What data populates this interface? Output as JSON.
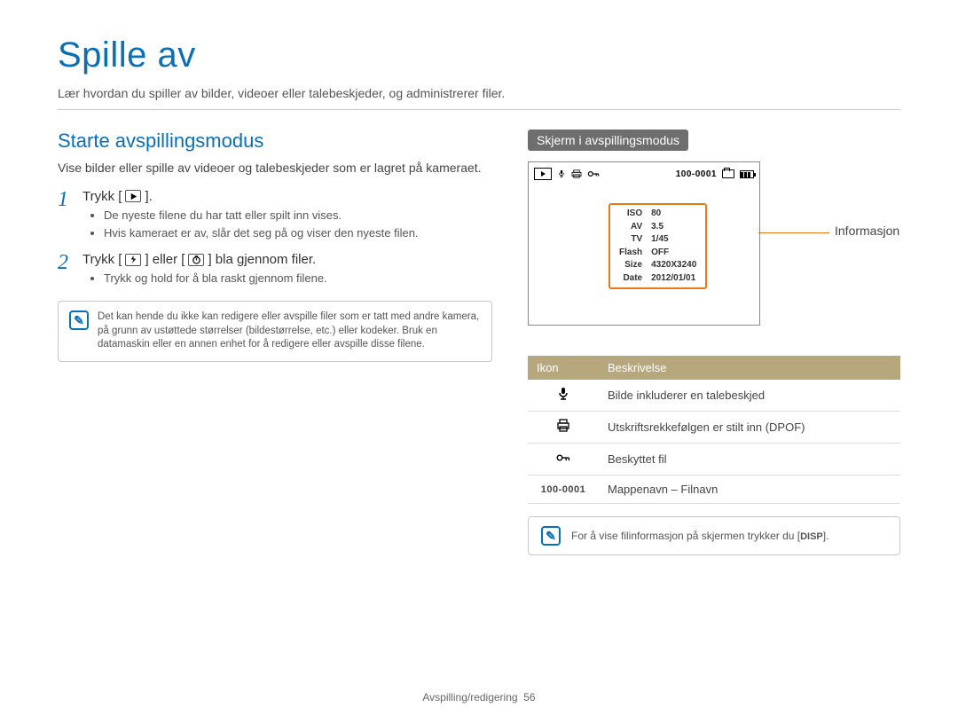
{
  "page": {
    "title": "Spille av",
    "subtitle": "Lær hvordan du spiller av bilder, videoer eller talebeskjeder, og administrerer filer."
  },
  "left": {
    "section_title": "Starte avspillingsmodus",
    "section_body": "Vise bilder eller spille av videoer og talebeskjeder som er lagret på kameraet.",
    "steps": [
      {
        "num": "1",
        "main_before": "Trykk [",
        "main_after": "].",
        "bullets": [
          "De nyeste filene du har tatt eller spilt inn vises.",
          "Hvis kameraet er av, slår det seg på og viser den nyeste filen."
        ]
      },
      {
        "num": "2",
        "main_before": "Trykk [",
        "main_mid": "] eller [",
        "main_after": "] bla gjennom filer.",
        "sub": "Trykk og hold for å bla raskt gjennom filene."
      }
    ],
    "note": "Det kan hende du ikke kan redigere eller avspille filer som er tatt med andre kamera, på grunn av ustøttede størrelser (bildestørrelse, etc.) eller kodeker. Bruk en datamaskin eller en annen enhet for å redigere eller avspille disse filene."
  },
  "right": {
    "badge": "Skjerm i avspillingsmodus",
    "cam_top_label": "100-0001",
    "info_panel": {
      "ISO": "80",
      "AV": "3.5",
      "TV": "1/45",
      "Flash": "OFF",
      "Size": "4320X3240",
      "Date": "2012/01/01"
    },
    "lead_label": "Informasjon",
    "table": {
      "head_icon": "Ikon",
      "head_desc": "Beskrivelse",
      "rows": [
        {
          "icon": "mic",
          "desc": "Bilde inkluderer en talebeskjed"
        },
        {
          "icon": "printer",
          "desc": "Utskriftsrekkefølgen er stilt inn (DPOF)"
        },
        {
          "icon": "key",
          "desc": "Beskyttet fil"
        },
        {
          "icon": "label100",
          "desc": "Mappenavn – Filnavn"
        }
      ]
    },
    "tip_before": "For å vise filinformasjon på skjermen trykker du [",
    "tip_btn": "DISP",
    "tip_after": "]."
  },
  "footer": {
    "section": "Avspilling/redigering",
    "page_no": "56"
  }
}
